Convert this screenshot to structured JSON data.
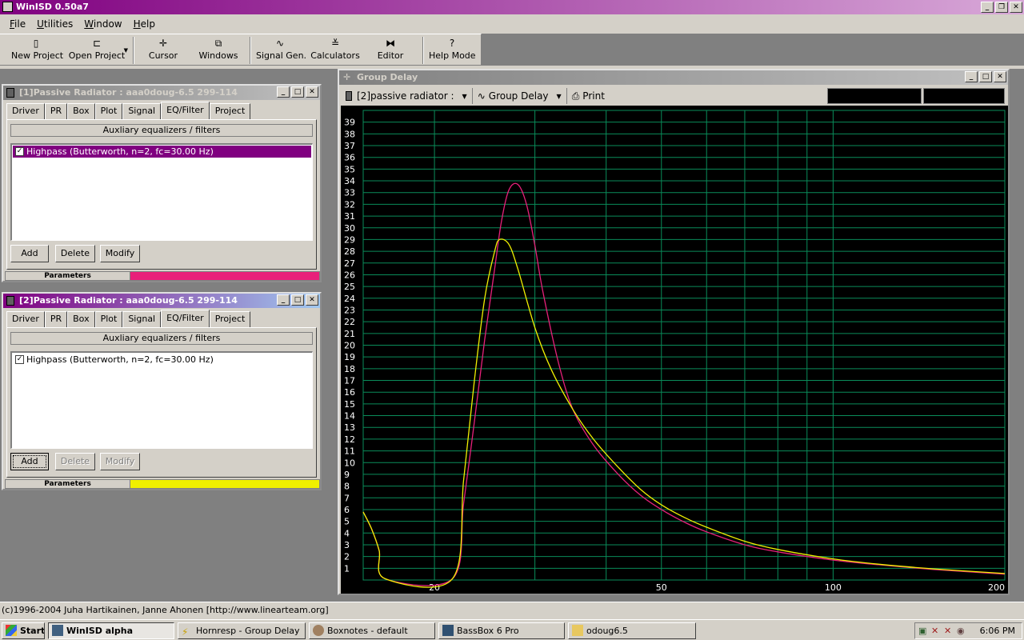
{
  "app": {
    "title": "WinISD 0.50a7"
  },
  "menu": [
    "File",
    "Utilities",
    "Window",
    "Help"
  ],
  "toolbar": {
    "new_project": "New Project",
    "open_project": "Open Project",
    "cursor": "Cursor",
    "windows": "Windows",
    "signal_gen": "Signal Gen.",
    "calculators": "Calculators",
    "editor": "Editor",
    "help_mode": "Help Mode"
  },
  "project1": {
    "title": "[1]Passive Radiator : aaa0doug-6.5 299-114",
    "tabs": [
      "Driver",
      "PR",
      "Box",
      "Plot",
      "Signal",
      "EQ/Filter",
      "Project"
    ],
    "aux_label": "Auxliary equalizers / filters",
    "filters": [
      "Highpass (Butterworth, n=2, fc=30.00 Hz)"
    ],
    "add": "Add",
    "delete": "Delete",
    "modify": "Modify",
    "parameters": "Parameters",
    "color": "#e8207a"
  },
  "project2": {
    "title": "[2]Passive Radiator : aaa0doug-6.5 299-114",
    "tabs": [
      "Driver",
      "PR",
      "Box",
      "Plot",
      "Signal",
      "EQ/Filter",
      "Project"
    ],
    "aux_label": "Auxliary equalizers / filters",
    "filters": [
      "Highpass (Butterworth, n=2, fc=30.00 Hz)"
    ],
    "add": "Add",
    "delete": "Delete",
    "modify": "Modify",
    "parameters": "Parameters",
    "color": "#f0f000"
  },
  "group_delay": {
    "title": "Group Delay",
    "project_select": "[2]passive radiator :",
    "plot_select": "Group Delay",
    "print": "Print"
  },
  "chart_data": {
    "type": "line",
    "x_scale": "log",
    "xlim": [
      15,
      200
    ],
    "ylim": [
      0,
      40
    ],
    "x_tick_labels": [
      20,
      50,
      100,
      200
    ],
    "y_tick_labels": [
      1,
      2,
      3,
      4,
      5,
      6,
      7,
      8,
      9,
      10,
      11,
      12,
      13,
      14,
      15,
      16,
      17,
      18,
      19,
      20,
      21,
      22,
      23,
      24,
      25,
      26,
      27,
      28,
      29,
      30,
      31,
      32,
      33,
      34,
      35,
      36,
      37,
      38,
      39
    ],
    "grid": true,
    "colors": {
      "background": "#000000",
      "grid": "#0a8c5a",
      "axis_text": "#ffffff"
    },
    "series": [
      {
        "color": "#e8207a",
        "x": [
          15,
          15.5,
          16,
          16.4,
          21.5,
          22.5,
          23.5,
          24.5,
          25.5,
          26.2,
          27,
          28,
          29,
          30,
          31,
          33,
          35,
          38,
          42,
          46,
          50,
          55,
          60,
          70,
          80,
          100,
          120,
          150,
          200
        ],
        "y": [
          5.8,
          4.4,
          2.5,
          0.1,
          0.1,
          6.5,
          13.5,
          20.5,
          26.5,
          30.5,
          33.2,
          33.7,
          32.0,
          28.5,
          24.5,
          18.5,
          14.5,
          11.5,
          9.0,
          7.2,
          6.0,
          4.9,
          4.1,
          3.0,
          2.4,
          1.7,
          1.3,
          0.9,
          0.5
        ]
      },
      {
        "color": "#f0f000",
        "x": [
          15,
          15.5,
          16,
          16.4,
          21.5,
          22.5,
          23.5,
          24.5,
          25.5,
          26,
          27,
          28,
          30,
          32,
          35,
          38,
          42,
          46,
          50,
          55,
          60,
          70,
          80,
          100,
          120,
          150,
          200
        ],
        "y": [
          5.8,
          4.4,
          2.5,
          0.1,
          0.1,
          8.5,
          17.0,
          24.0,
          28.0,
          29.0,
          28.6,
          26.5,
          21.5,
          18.0,
          14.5,
          12.0,
          9.6,
          7.7,
          6.4,
          5.3,
          4.5,
          3.3,
          2.6,
          1.8,
          1.35,
          0.95,
          0.55
        ]
      }
    ]
  },
  "status": {
    "text": "(c)1996-2004 Juha Hartikainen, Janne Ahonen [http://www.linearteam.org]"
  },
  "taskbar": {
    "start": "Start",
    "tasks": [
      "WinISD alpha",
      "Hornresp - Group Delay",
      "Boxnotes - default",
      "BassBox 6 Pro",
      "odoug6.5"
    ],
    "clock": "6:06 PM"
  }
}
